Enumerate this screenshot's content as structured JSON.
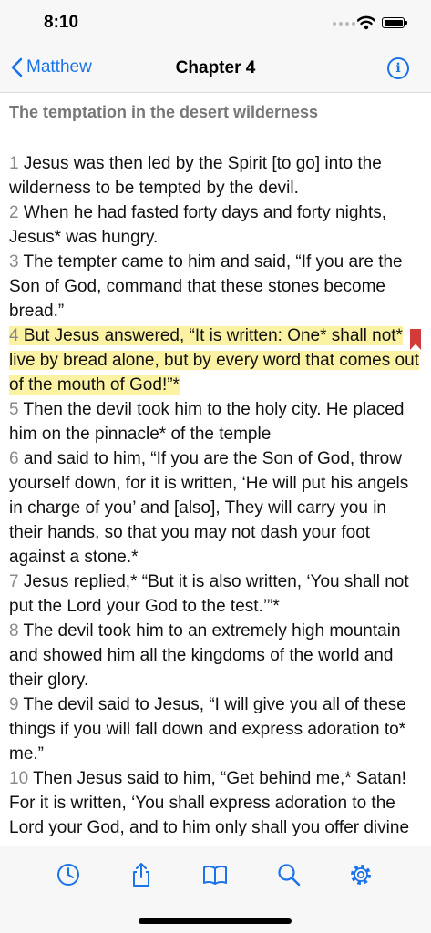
{
  "status": {
    "time": "8:10"
  },
  "nav": {
    "back_label": "Matthew",
    "title": "Chapter 4",
    "info_glyph": "i"
  },
  "section": {
    "heading": "The temptation in the desert wilderness"
  },
  "verses": [
    {
      "num": "1",
      "text": "Jesus was then led by the Spirit [to go] into the wilderness to be tempted by the devil.",
      "highlighted": false
    },
    {
      "num": "2",
      "text": "When he had fasted forty days and forty nights, Jesus* was hungry.",
      "highlighted": false
    },
    {
      "num": "3",
      "text": "The tempter came to him and said, “If you are the Son of God, command that these stones become bread.”",
      "highlighted": false
    },
    {
      "num": "4",
      "text": "But Jesus answered, “It is written: One* shall not* live by bread alone, but by every word that comes out of the mouth of God!”*",
      "highlighted": true,
      "bookmarked": true
    },
    {
      "num": "5",
      "text": "Then the devil took him to the holy city. He placed him on the pinnacle* of the temple",
      "highlighted": false
    },
    {
      "num": "6",
      "text": "and said to him, “If you are the Son of God, throw yourself down, for it is written, ‘He will put his angels in charge of you’ and [also], They will carry you in their hands, so that you may not dash your foot against a stone.*",
      "highlighted": false
    },
    {
      "num": "7",
      "text": "Jesus replied,* “But it is also written, ‘You shall not put the Lord your God to the test.’”*",
      "highlighted": false
    },
    {
      "num": "8",
      "text": "The devil took him to an extremely high mountain and showed him all the kingdoms of the world and their glory.",
      "highlighted": false
    },
    {
      "num": "9",
      "text": "The devil said to Jesus, “I will give you all of these things if you will fall down and express adoration to* me.”",
      "highlighted": false
    },
    {
      "num": "10",
      "text": "Then Jesus said to him, “Get behind me,* Satan! For it is written, ‘You shall express adoration to the Lord your God, and to him only shall you offer divine",
      "highlighted": false
    }
  ],
  "toolbar": {
    "items": [
      {
        "name": "history",
        "icon": "clock-icon"
      },
      {
        "name": "share",
        "icon": "share-icon"
      },
      {
        "name": "books",
        "icon": "book-icon"
      },
      {
        "name": "search",
        "icon": "search-icon"
      },
      {
        "name": "settings",
        "icon": "gear-icon"
      }
    ]
  },
  "colors": {
    "accent": "#1a73e8",
    "highlight": "#fbf2a3",
    "bookmark": "#d33a3a",
    "verse_number": "#8a8a8a",
    "heading": "#777777"
  }
}
